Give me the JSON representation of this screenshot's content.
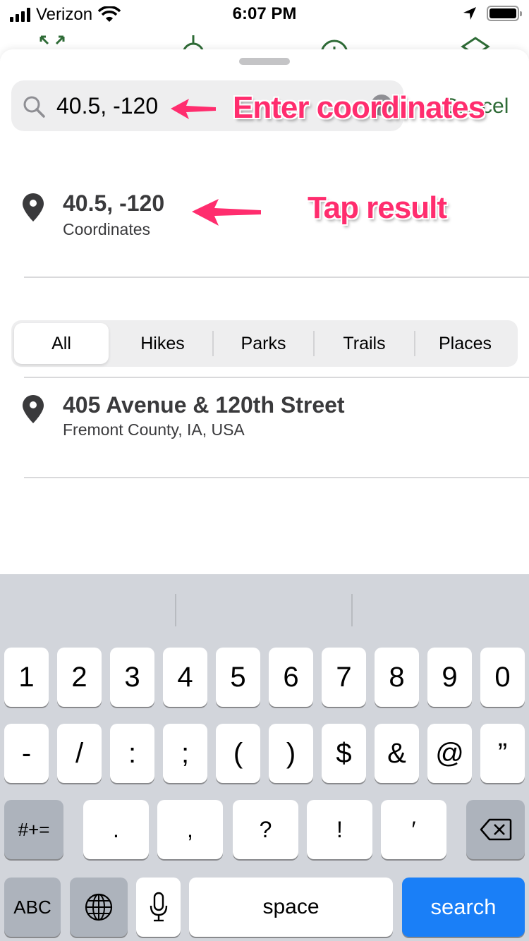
{
  "status_bar": {
    "carrier": "Verizon",
    "time": "6:07 PM",
    "signal_bars": 4,
    "battery_level": 1.0
  },
  "map_toolbar": {
    "icons": [
      "expand-icon",
      "compass-icon",
      "info-icon",
      "layers-icon"
    ],
    "accent_color": "#2e6b36"
  },
  "search": {
    "value": "40.5, -120",
    "placeholder": "",
    "cancel_label": "Cancel"
  },
  "top_result": {
    "title": "40.5, -120",
    "subtitle": "Coordinates"
  },
  "filters": {
    "selected": "All",
    "tabs": [
      "All",
      "Hikes",
      "Parks",
      "Trails",
      "Places"
    ]
  },
  "results": [
    {
      "title": "405 Avenue & 120th Street",
      "subtitle": "Fremont County, IA, USA"
    }
  ],
  "annotations": {
    "enter": "Enter coordinates",
    "tap": "Tap result",
    "color": "#ff2d6e"
  },
  "keyboard": {
    "row1": [
      "1",
      "2",
      "3",
      "4",
      "5",
      "6",
      "7",
      "8",
      "9",
      "0"
    ],
    "row2": [
      "-",
      "/",
      ":",
      ";",
      "(",
      ")",
      "$",
      "&",
      "@",
      "”"
    ],
    "row3": [
      ".",
      ",",
      "?",
      "!",
      "′"
    ],
    "more_symbols": "#+=",
    "abc": "ABC",
    "space": "space",
    "search": "search",
    "search_color": "#1a7ff7"
  }
}
